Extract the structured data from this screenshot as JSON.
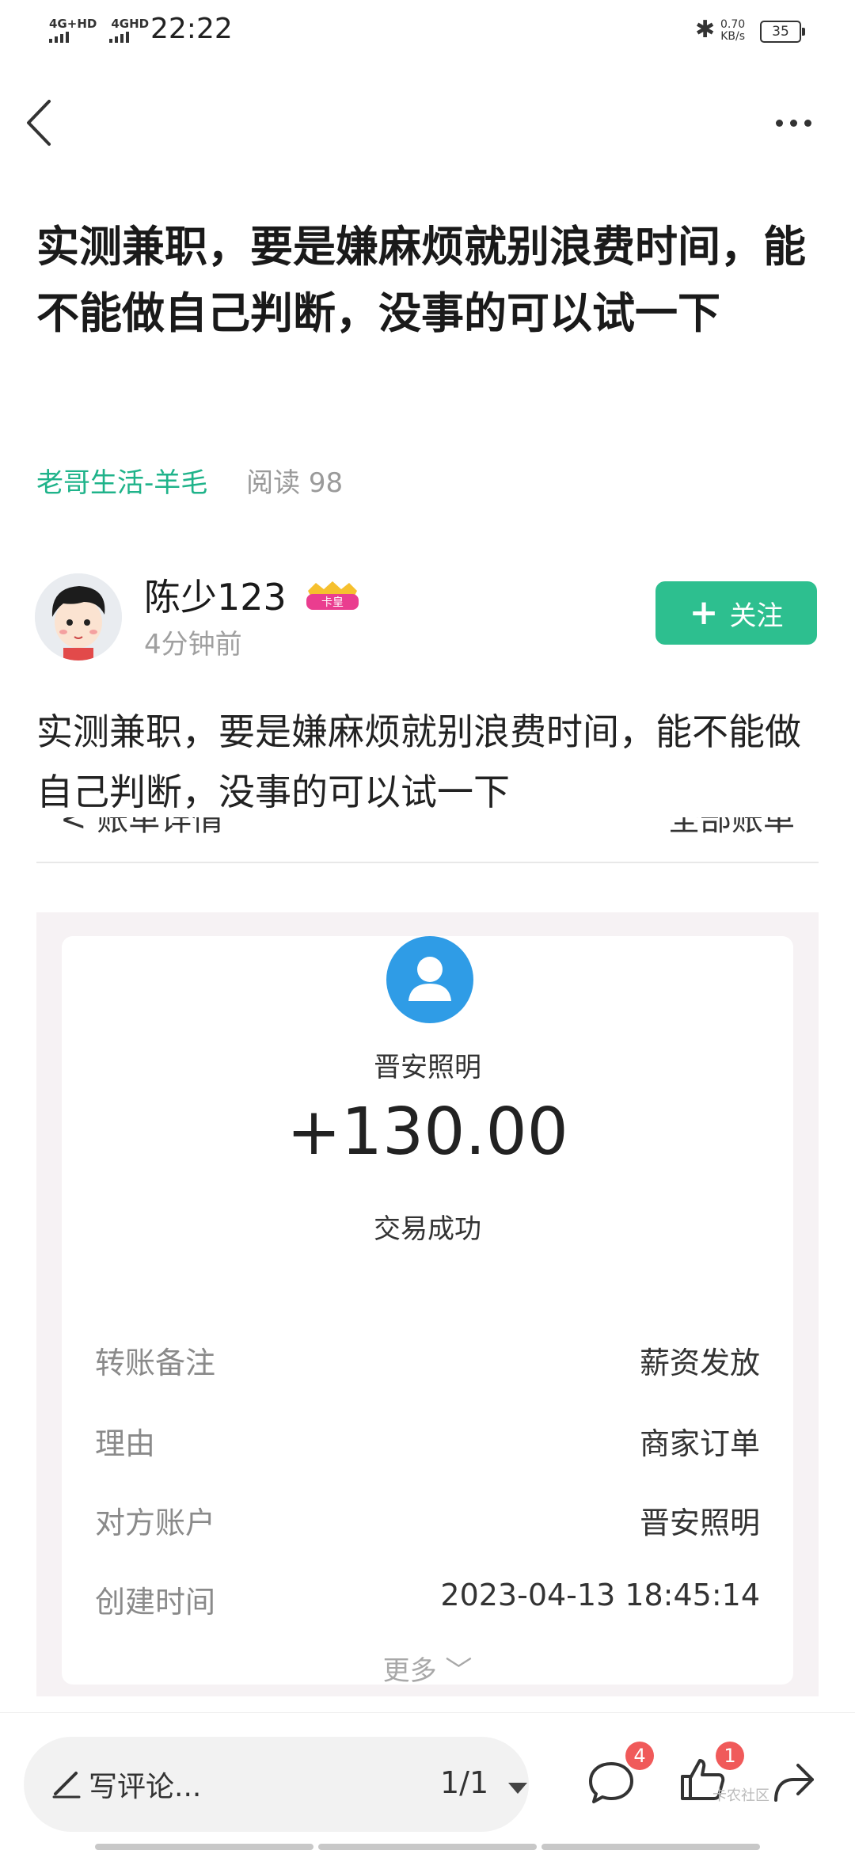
{
  "status_bar": {
    "network_1": "4G+HD",
    "network_2": "4GHD",
    "time": "22:22",
    "speed_value": "0.70",
    "speed_unit": "KB/s",
    "battery": "35"
  },
  "article": {
    "title": "实测兼职，要是嫌麻烦就别浪费时间，能不能做自己判断，没事的可以试一下",
    "category": "老哥生活-羊毛",
    "reads": "阅读 98",
    "body": "实测兼职，要是嫌麻烦就别浪费时间，能不能做自己判断，没事的可以试一下"
  },
  "author": {
    "name": "陈少123",
    "badge": "卡皇",
    "time": "4分钟前",
    "follow_label": "关注"
  },
  "screenshot": {
    "header_left": "< 账单详情",
    "header_right": "全部账单",
    "payee": "晋安照明",
    "amount": "+130.00",
    "status": "交易成功",
    "rows": [
      {
        "key": "转账备注",
        "value": "薪资发放"
      },
      {
        "key": "理由",
        "value": "商家订单"
      },
      {
        "key": "对方账户",
        "value": "晋安照明"
      },
      {
        "key": "创建时间",
        "value": "2023-04-13 18:45:14"
      }
    ],
    "more": "更多 ﹀"
  },
  "bottom": {
    "comment_placeholder": "写评论...",
    "page_indicator": "1/1",
    "comment_count": "4",
    "like_count": "1",
    "watermark": "卡农社区"
  },
  "colors": {
    "accent_green": "#2dbf8f",
    "category_green": "#1fb38a",
    "badge_red": "#f05a5a",
    "payee_blue": "#2f9ce6"
  }
}
